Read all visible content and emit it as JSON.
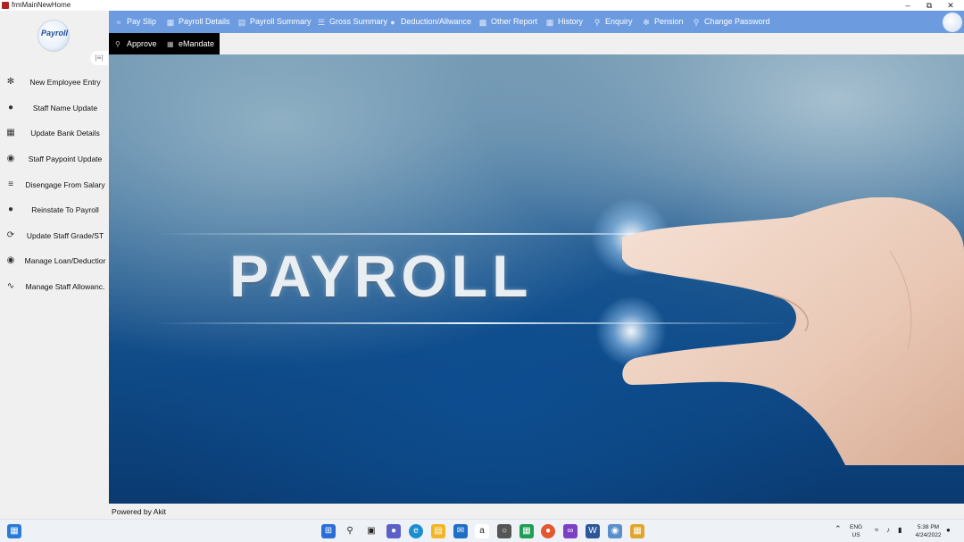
{
  "window": {
    "title": "frmMainNewHome"
  },
  "sidebar": {
    "logo_text": "Payroll",
    "items": [
      {
        "label": "New Employee Entry",
        "icon": "users-icon"
      },
      {
        "label": "Staff Name Update",
        "icon": "user-icon"
      },
      {
        "label": "Update Bank Details",
        "icon": "bank-icon"
      },
      {
        "label": "Staff Paypoint Update",
        "icon": "location-pin-icon"
      },
      {
        "label": "Disengage From Salary",
        "icon": "disengage-icon"
      },
      {
        "label": "Reinstate To Payroll",
        "icon": "reinstate-icon"
      },
      {
        "label": "Update Staff Grade/ST",
        "icon": "refresh-icon"
      },
      {
        "label": "Manage Loan/Deductior",
        "icon": "loan-icon"
      },
      {
        "label": "Manage Staff Allowanc.",
        "icon": "allowance-icon"
      }
    ]
  },
  "menubar": {
    "items": [
      {
        "label": "Pay Slip",
        "icon": "pay-slip-icon"
      },
      {
        "label": "Payroll Details",
        "icon": "payroll-details-icon"
      },
      {
        "label": "Payroll Summary",
        "icon": "document-icon"
      },
      {
        "label": "Gross Summary",
        "icon": "list-icon"
      },
      {
        "label": "Deduction/Allwance",
        "icon": "minus-circle-icon"
      },
      {
        "label": "Other Report",
        "icon": "printer-icon"
      },
      {
        "label": "History",
        "icon": "book-icon"
      },
      {
        "label": "Enquiry",
        "icon": "search-icon"
      },
      {
        "label": "Pension",
        "icon": "people-icon"
      },
      {
        "label": "Change Password",
        "icon": "key-icon"
      }
    ]
  },
  "submenu": {
    "items": [
      {
        "label": "Approve",
        "icon": "approve-icon"
      },
      {
        "label": "eMandate",
        "icon": "emandate-icon"
      }
    ]
  },
  "banner": {
    "text": "PAYROLL"
  },
  "status": {
    "text": "Powered by Akit"
  },
  "taskbar": {
    "tray_lang": "ENG",
    "tray_region": "US",
    "time": "5:38 PM",
    "date": "4/24/2022"
  }
}
